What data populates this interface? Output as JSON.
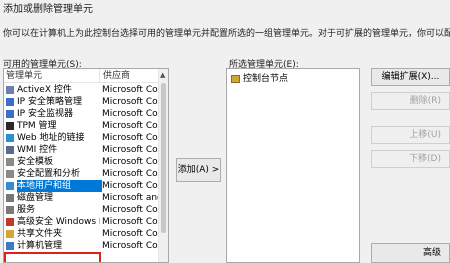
{
  "window": {
    "title": "添加或删除管理单元",
    "description": "你可以在计算机上为此控制台选择可用的管理单元并配置所选的一组管理单元。对于可扩展的管理单元，你可以配置要启用哪些扩展项。"
  },
  "available": {
    "label": "可用的管理单元(S):",
    "col_name": "管理单元",
    "col_vendor": "供应商",
    "rows": [
      {
        "name": "ActiveX 控件",
        "vendor": "Microsoft Cor...",
        "icon": "activex-icon",
        "color": "#6b7fb4"
      },
      {
        "name": "IP 安全策略管理",
        "vendor": "Microsoft Cor...",
        "icon": "ip-security-icon",
        "color": "#3c6fc9"
      },
      {
        "name": "IP 安全监视器",
        "vendor": "Microsoft Cor...",
        "icon": "ip-monitor-icon",
        "color": "#3c6fc9"
      },
      {
        "name": "TPM 管理",
        "vendor": "Microsoft Cor...",
        "icon": "tpm-icon",
        "color": "#2a2a2a"
      },
      {
        "name": "Web 地址的链接",
        "vendor": "Microsoft Cor...",
        "icon": "web-link-icon",
        "color": "#2b8fd6"
      },
      {
        "name": "WMI 控件",
        "vendor": "Microsoft Cor...",
        "icon": "wmi-icon",
        "color": "#5a6c8c"
      },
      {
        "name": "安全模板",
        "vendor": "Microsoft Cor...",
        "icon": "security-template-icon",
        "color": "#8a8a8a"
      },
      {
        "name": "安全配置和分析",
        "vendor": "Microsoft Cor...",
        "icon": "security-config-icon",
        "color": "#8a8a8a"
      },
      {
        "name": "本地用户和组",
        "vendor": "Microsoft Cor...",
        "icon": "users-groups-icon",
        "color": "#3a8ad8",
        "selected": true
      },
      {
        "name": "磁盘管理",
        "vendor": "Microsoft and...",
        "icon": "disk-icon",
        "color": "#777777"
      },
      {
        "name": "服务",
        "vendor": "Microsoft Cor...",
        "icon": "services-icon",
        "color": "#7a7a7a"
      },
      {
        "name": "高级安全 Windows De...",
        "vendor": "Microsoft Cor...",
        "icon": "firewall-icon",
        "color": "#c03a2a"
      },
      {
        "name": "共享文件夹",
        "vendor": "Microsoft Cor...",
        "icon": "shared-folder-icon",
        "color": "#d4a634"
      },
      {
        "name": "计算机管理",
        "vendor": "Microsoft Cor...",
        "icon": "computer-mgmt-icon",
        "color": "#3a7ac8"
      }
    ]
  },
  "add_button": "添加(A) >",
  "selected": {
    "label": "所选管理单元(E):",
    "items": [
      {
        "name": "控制台节点",
        "icon": "folder-icon"
      }
    ]
  },
  "buttons": {
    "edit_ext": "编辑扩展(X)...",
    "remove": "删除(R)",
    "move_up": "上移(U)",
    "move_down": "下移(D)",
    "advanced": "高级"
  }
}
